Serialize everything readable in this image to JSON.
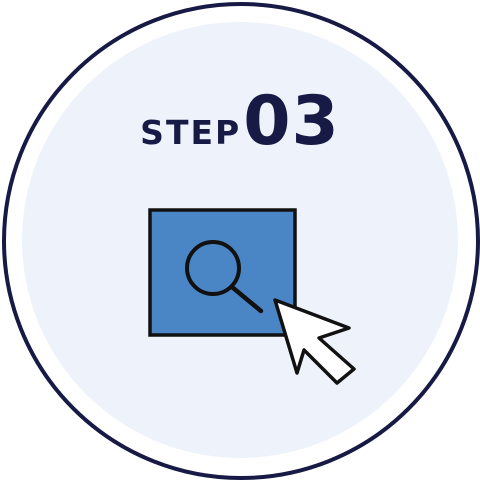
{
  "badge": {
    "step_word": "STEP",
    "step_number": "03"
  },
  "icons": {
    "magnifier": "search-icon",
    "pointer": "cursor-arrow-icon"
  },
  "colors": {
    "navy": "#161a45",
    "disc_background": "#eef3fb",
    "panel_blue": "#4a86c6",
    "cursor_fill": "#ffffff"
  }
}
